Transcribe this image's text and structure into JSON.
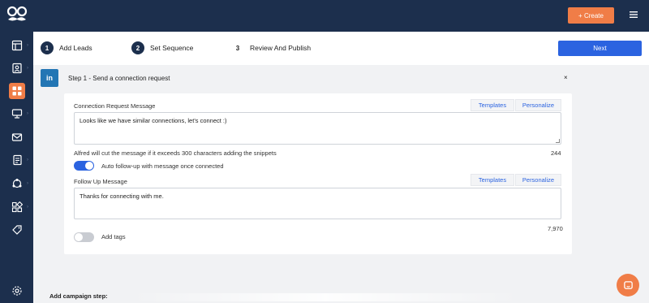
{
  "header": {
    "create_label": "+ Create",
    "logo_icon": "mustache-glasses-logo",
    "menu_icon": "hamburger-icon"
  },
  "sidebar": {
    "items": [
      {
        "icon": "layout-icon",
        "active": false
      },
      {
        "icon": "contact-icon",
        "active": false
      },
      {
        "icon": "grid-icon",
        "active": true
      },
      {
        "icon": "monitor-icon",
        "active": false
      },
      {
        "icon": "mail-icon",
        "active": false
      },
      {
        "icon": "document-icon",
        "active": false
      },
      {
        "icon": "network-icon",
        "active": false
      },
      {
        "icon": "apps-icon",
        "active": false
      },
      {
        "icon": "tag-icon",
        "active": false
      }
    ],
    "settings_icon": "gear-icon"
  },
  "steps": [
    {
      "num": "1",
      "label": "Add Leads"
    },
    {
      "num": "2",
      "label": "Set Sequence"
    },
    {
      "num": "3",
      "label": "Review And Publish"
    }
  ],
  "next_label": "Next",
  "step_header": {
    "badge": "in",
    "title": "Step 1 - Send a connection request",
    "close": "×"
  },
  "connection": {
    "label": "Connection Request Message",
    "templates_label": "Templates",
    "personalize_label": "Personalize",
    "message": "Looks like we have similar connections, let's connect :)",
    "hint": "Alfred will cut the message if it exceeds 300 characters adding the snippets",
    "count": "244"
  },
  "auto_followup": {
    "label": "Auto follow-up with message once connected",
    "enabled": true
  },
  "followup": {
    "label": "Follow Up Message",
    "templates_label": "Templates",
    "personalize_label": "Personalize",
    "message": "Thanks for connecting with me.",
    "count": "7,970"
  },
  "tags": {
    "label": "Add tags",
    "enabled": false
  },
  "add_campaign_step": "Add campaign step:",
  "colors": {
    "navy": "#1c2f4d",
    "orange": "#f07d47",
    "blue": "#2b63e0",
    "linkedin": "#2376b4"
  }
}
